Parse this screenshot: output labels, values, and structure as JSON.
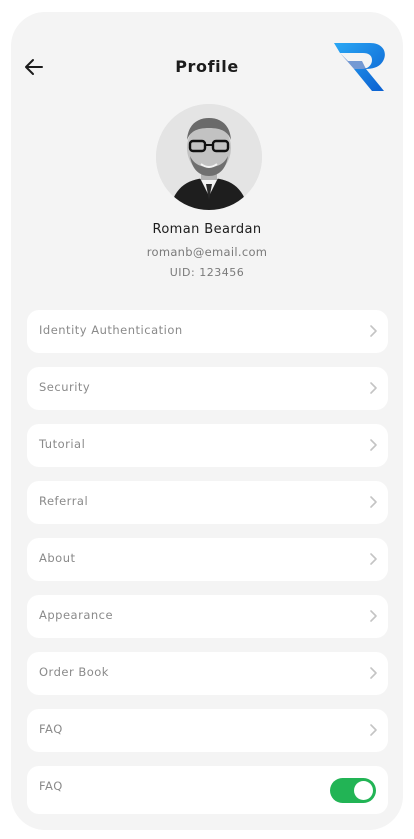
{
  "header": {
    "title": "Profile",
    "back_icon": "arrow-left-icon",
    "logo_icon": "brand-r-logo-icon",
    "logo_colors": {
      "light": "#1e9bf0",
      "dark": "#0b5fd0"
    }
  },
  "profile": {
    "name": "Roman Beardan",
    "email": "romanb@email.com",
    "uid_label": "UID:",
    "uid_value": "123456"
  },
  "menu": {
    "items": [
      {
        "label": "Identity Authentication",
        "icon": "chevron-right-icon"
      },
      {
        "label": "Security",
        "icon": "chevron-right-icon"
      },
      {
        "label": "Tutorial",
        "icon": "chevron-right-icon"
      },
      {
        "label": "Referral",
        "icon": "chevron-right-icon"
      },
      {
        "label": "About",
        "icon": "chevron-right-icon"
      },
      {
        "label": "Appearance",
        "icon": "chevron-right-icon"
      },
      {
        "label": "Order Book",
        "icon": "chevron-right-icon"
      },
      {
        "label": "FAQ",
        "icon": "chevron-right-icon"
      }
    ],
    "toggle_item": {
      "label": "FAQ",
      "state": "on",
      "color": "#22b455"
    }
  }
}
